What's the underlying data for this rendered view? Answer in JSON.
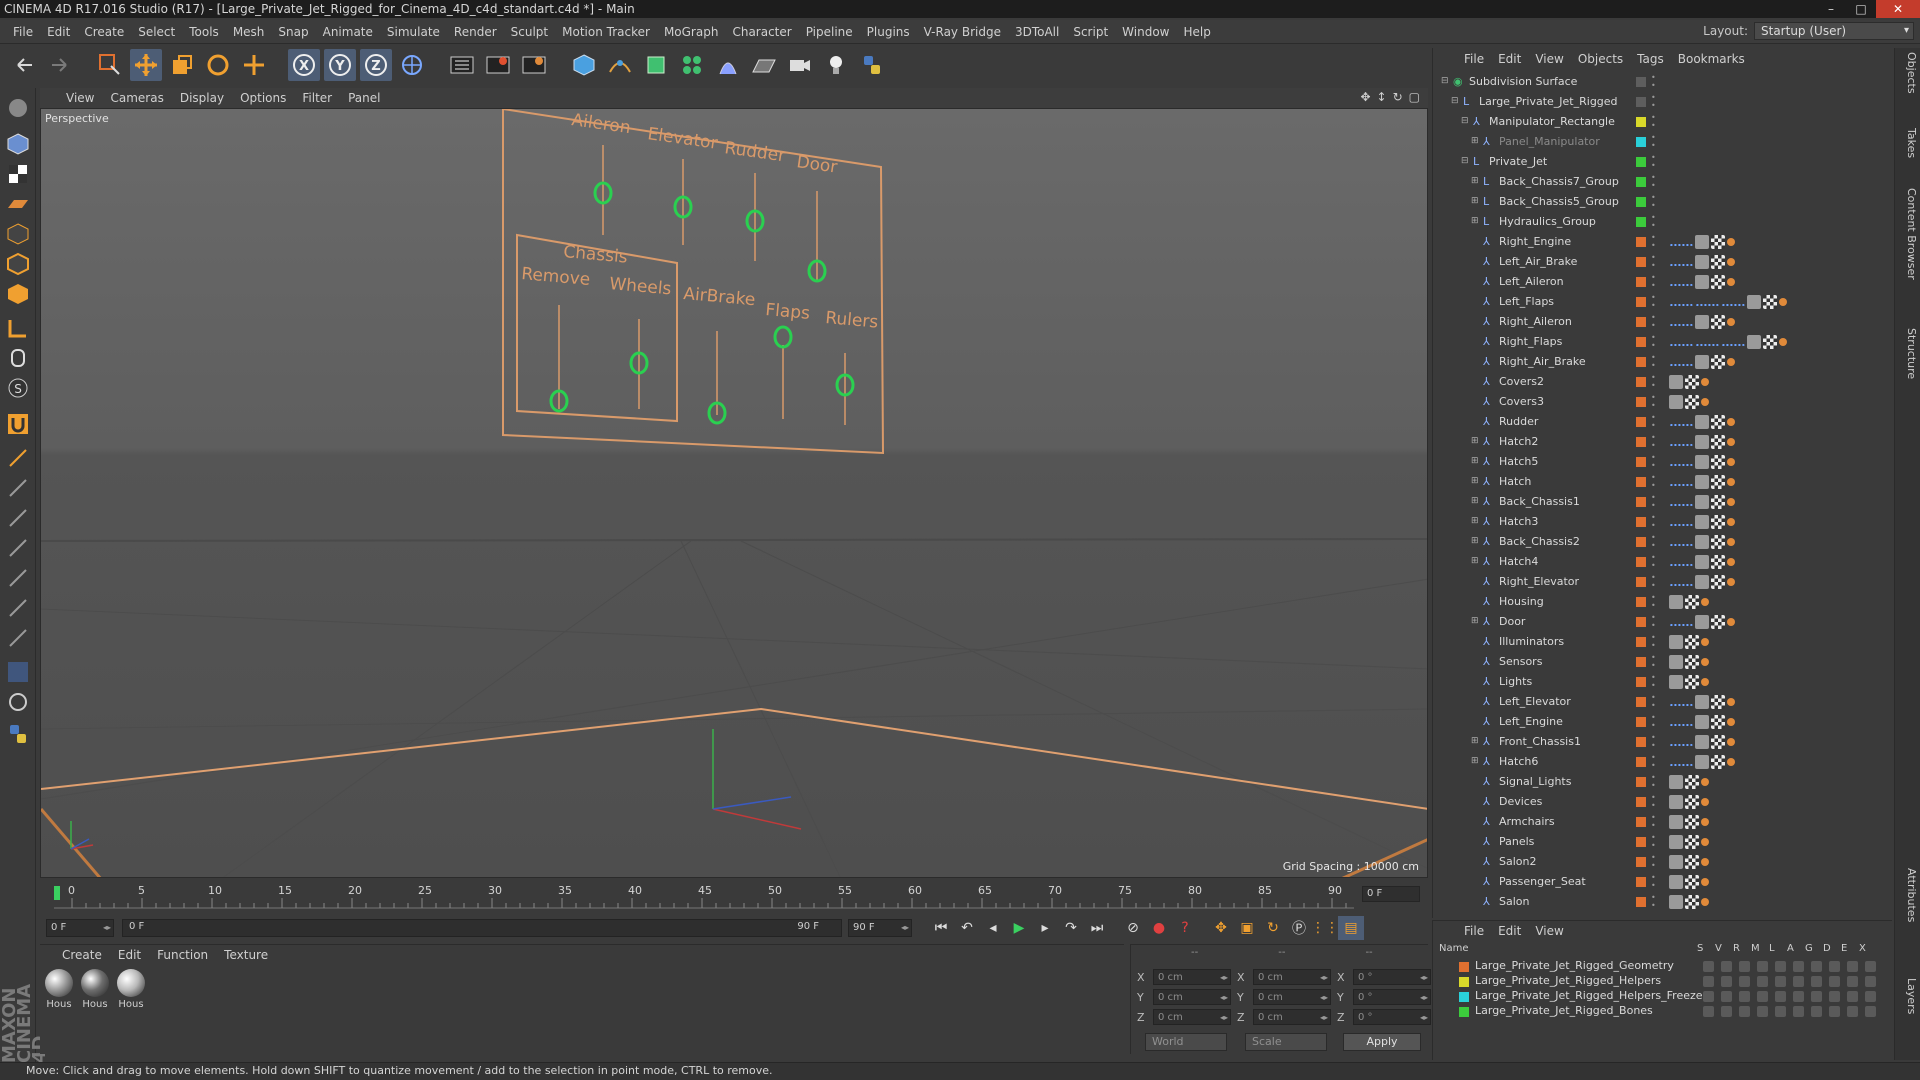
{
  "window": {
    "title": "CINEMA 4D R17.016 Studio (R17) - [Large_Private_Jet_Rigged_for_Cinema_4D_c4d_standart.c4d *] - Main"
  },
  "menubar": {
    "items": [
      "File",
      "Edit",
      "Create",
      "Select",
      "Tools",
      "Mesh",
      "Snap",
      "Animate",
      "Simulate",
      "Render",
      "Sculpt",
      "Motion Tracker",
      "MoGraph",
      "Character",
      "Pipeline",
      "Plugins",
      "V-Ray Bridge",
      "3DToAll",
      "Script",
      "Window",
      "Help"
    ],
    "layout_label": "Layout:",
    "layout_value": "Startup (User)"
  },
  "toolbar": {
    "icons": [
      "undo-icon",
      "redo-icon",
      "live-select-icon",
      "move-icon",
      "scale-icon",
      "rotate-icon",
      "move-active-icon",
      "x-axis-icon",
      "y-axis-icon",
      "z-axis-icon",
      "world-coords-icon",
      "render-view-icon",
      "render-picture-viewer-icon",
      "edit-render-settings-icon",
      "cube-icon",
      "pen-spline-icon",
      "subdivision-nurbs-icon",
      "cloner-icon",
      "deformer-icon",
      "floor-icon",
      "camera-icon",
      "light-icon",
      "python-icon"
    ],
    "axis_labels": {
      "x": "X",
      "y": "Y",
      "z": "Z"
    }
  },
  "viewport": {
    "menu": [
      "View",
      "Cameras",
      "Display",
      "Options",
      "Filter",
      "Panel"
    ],
    "camera_label": "Perspective",
    "grid_spacing": "Grid Spacing : 10000 cm",
    "panel_labels": {
      "aileron": "Aileron",
      "elevator": "Elevator",
      "rudder": "Rudder",
      "door": "Door",
      "chassis": "Chassis",
      "remove": "Remove",
      "wheels": "Wheels",
      "airbrake": "AirBrake",
      "flaps": "Flaps",
      "rulers": "Rulers"
    }
  },
  "timeline": {
    "ticks": [
      "0",
      "5",
      "10",
      "15",
      "20",
      "25",
      "30",
      "35",
      "40",
      "45",
      "50",
      "55",
      "60",
      "65",
      "70",
      "75",
      "80",
      "85",
      "90"
    ],
    "current_frame": "0 F"
  },
  "transport": {
    "start_frame": "0 F",
    "range_start": "0 F",
    "range_end": "90 F",
    "end_frame": "90 F"
  },
  "material_manager": {
    "menu": [
      "Create",
      "Edit",
      "Function",
      "Texture"
    ],
    "materials": [
      {
        "label": "Hous",
        "color": "#9a9a9a"
      },
      {
        "label": "Hous",
        "color": "#6e6e6e"
      },
      {
        "label": "Hous",
        "color": "#b8b8b8"
      }
    ]
  },
  "coordinates": {
    "headers": [
      "--",
      "--",
      "--"
    ],
    "rows": [
      {
        "axis": "X",
        "pos": "0 cm",
        "axis2": "X",
        "size": "0 cm",
        "axis3": "X",
        "rot": "0 °"
      },
      {
        "axis": "Y",
        "pos": "0 cm",
        "axis2": "Y",
        "size": "0 cm",
        "axis3": "Y",
        "rot": "0 °"
      },
      {
        "axis": "Z",
        "pos": "0 cm",
        "axis2": "Z",
        "size": "0 cm",
        "axis3": "Z",
        "rot": "0 °"
      }
    ],
    "mode_world": "World",
    "mode_scale": "Scale",
    "apply_label": "Apply"
  },
  "status": {
    "text": "Move: Click and drag to move elements. Hold down SHIFT to quantize movement / add to the selection in point mode, CTRL to remove."
  },
  "object_manager": {
    "menu": [
      "File",
      "Edit",
      "View",
      "Objects",
      "Tags",
      "Bookmarks"
    ],
    "objects": [
      {
        "name": "Subdivision Surface",
        "depth": 0,
        "exp": "−",
        "layer": "",
        "icon": "subdivision-icon"
      },
      {
        "name": "Large_Private_Jet_Rigged",
        "depth": 1,
        "exp": "−",
        "layer": "",
        "icon": "null-icon"
      },
      {
        "name": "Manipulator_Rectangle",
        "depth": 2,
        "exp": "−",
        "layer": "#d9d92a",
        "icon": "spline-icon"
      },
      {
        "name": "Panel_Manipulator",
        "depth": 3,
        "exp": "+",
        "layer": "#2ad0d9",
        "icon": "spline-icon",
        "dim": true
      },
      {
        "name": "Private_Jet",
        "depth": 2,
        "exp": "−",
        "layer": "#3ccb3c",
        "icon": "null-icon"
      },
      {
        "name": "Back_Chassis7_Group",
        "depth": 3,
        "exp": "+",
        "layer": "#3ccb3c",
        "icon": "null-icon"
      },
      {
        "name": "Back_Chassis5_Group",
        "depth": 3,
        "exp": "+",
        "layer": "#3ccb3c",
        "icon": "null-icon"
      },
      {
        "name": "Hydraulics_Group",
        "depth": 3,
        "exp": "+",
        "layer": "#3ccb3c",
        "icon": "null-icon"
      },
      {
        "name": "Right_Engine",
        "depth": 3,
        "exp": "",
        "layer": "#e07030",
        "icon": "polygon-icon",
        "tags": "full"
      },
      {
        "name": "Left_Air_Brake",
        "depth": 3,
        "exp": "",
        "layer": "#e07030",
        "icon": "polygon-icon",
        "tags": "full"
      },
      {
        "name": "Left_Aileron",
        "depth": 3,
        "exp": "",
        "layer": "#e07030",
        "icon": "polygon-icon",
        "tags": "full"
      },
      {
        "name": "Left_Flaps",
        "depth": 3,
        "exp": "",
        "layer": "#e07030",
        "icon": "polygon-icon",
        "tags": "long"
      },
      {
        "name": "Right_Aileron",
        "depth": 3,
        "exp": "",
        "layer": "#e07030",
        "icon": "polygon-icon",
        "tags": "full"
      },
      {
        "name": "Right_Flaps",
        "depth": 3,
        "exp": "",
        "layer": "#e07030",
        "icon": "polygon-icon",
        "tags": "long"
      },
      {
        "name": "Right_Air_Brake",
        "depth": 3,
        "exp": "",
        "layer": "#e07030",
        "icon": "polygon-icon",
        "tags": "full"
      },
      {
        "name": "Covers2",
        "depth": 3,
        "exp": "",
        "layer": "#e07030",
        "icon": "polygon-icon",
        "tags": "short"
      },
      {
        "name": "Covers3",
        "depth": 3,
        "exp": "",
        "layer": "#e07030",
        "icon": "polygon-icon",
        "tags": "short"
      },
      {
        "name": "Rudder",
        "depth": 3,
        "exp": "",
        "layer": "#e07030",
        "icon": "polygon-icon",
        "tags": "full"
      },
      {
        "name": "Hatch2",
        "depth": 3,
        "exp": "+",
        "layer": "#e07030",
        "icon": "polygon-icon",
        "tags": "full"
      },
      {
        "name": "Hatch5",
        "depth": 3,
        "exp": "+",
        "layer": "#e07030",
        "icon": "polygon-icon",
        "tags": "full"
      },
      {
        "name": "Hatch",
        "depth": 3,
        "exp": "+",
        "layer": "#e07030",
        "icon": "polygon-icon",
        "tags": "full"
      },
      {
        "name": "Back_Chassis1",
        "depth": 3,
        "exp": "+",
        "layer": "#e07030",
        "icon": "polygon-icon",
        "tags": "full"
      },
      {
        "name": "Hatch3",
        "depth": 3,
        "exp": "+",
        "layer": "#e07030",
        "icon": "polygon-icon",
        "tags": "full"
      },
      {
        "name": "Back_Chassis2",
        "depth": 3,
        "exp": "+",
        "layer": "#e07030",
        "icon": "polygon-icon",
        "tags": "full"
      },
      {
        "name": "Hatch4",
        "depth": 3,
        "exp": "+",
        "layer": "#e07030",
        "icon": "polygon-icon",
        "tags": "full"
      },
      {
        "name": "Right_Elevator",
        "depth": 3,
        "exp": "",
        "layer": "#e07030",
        "icon": "polygon-icon",
        "tags": "full"
      },
      {
        "name": "Housing",
        "depth": 3,
        "exp": "",
        "layer": "#e07030",
        "icon": "polygon-icon",
        "tags": "short"
      },
      {
        "name": "Door",
        "depth": 3,
        "exp": "+",
        "layer": "#e07030",
        "icon": "polygon-icon",
        "tags": "full"
      },
      {
        "name": "Illuminators",
        "depth": 3,
        "exp": "",
        "layer": "#e07030",
        "icon": "polygon-icon",
        "tags": "short"
      },
      {
        "name": "Sensors",
        "depth": 3,
        "exp": "",
        "layer": "#e07030",
        "icon": "polygon-icon",
        "tags": "short"
      },
      {
        "name": "Lights",
        "depth": 3,
        "exp": "",
        "layer": "#e07030",
        "icon": "polygon-icon",
        "tags": "short"
      },
      {
        "name": "Left_Elevator",
        "depth": 3,
        "exp": "",
        "layer": "#e07030",
        "icon": "polygon-icon",
        "tags": "full"
      },
      {
        "name": "Left_Engine",
        "depth": 3,
        "exp": "",
        "layer": "#e07030",
        "icon": "polygon-icon",
        "tags": "full"
      },
      {
        "name": "Front_Chassis1",
        "depth": 3,
        "exp": "+",
        "layer": "#e07030",
        "icon": "polygon-icon",
        "tags": "full"
      },
      {
        "name": "Hatch6",
        "depth": 3,
        "exp": "+",
        "layer": "#e07030",
        "icon": "polygon-icon",
        "tags": "full"
      },
      {
        "name": "Signal_Lights",
        "depth": 3,
        "exp": "",
        "layer": "#e07030",
        "icon": "polygon-icon",
        "tags": "short"
      },
      {
        "name": "Devices",
        "depth": 3,
        "exp": "",
        "layer": "#e07030",
        "icon": "polygon-icon",
        "tags": "short"
      },
      {
        "name": "Armchairs",
        "depth": 3,
        "exp": "",
        "layer": "#e07030",
        "icon": "polygon-icon",
        "tags": "short"
      },
      {
        "name": "Panels",
        "depth": 3,
        "exp": "",
        "layer": "#e07030",
        "icon": "polygon-icon",
        "tags": "short"
      },
      {
        "name": "Salon2",
        "depth": 3,
        "exp": "",
        "layer": "#e07030",
        "icon": "polygon-icon",
        "tags": "short"
      },
      {
        "name": "Passenger_Seat",
        "depth": 3,
        "exp": "",
        "layer": "#e07030",
        "icon": "polygon-icon",
        "tags": "short"
      },
      {
        "name": "Salon",
        "depth": 3,
        "exp": "",
        "layer": "#e07030",
        "icon": "polygon-icon",
        "tags": "short"
      }
    ]
  },
  "layer_manager": {
    "menu": [
      "File",
      "Edit",
      "View"
    ],
    "header_name": "Name",
    "header_cols": [
      "S",
      "V",
      "R",
      "M",
      "L",
      "A",
      "G",
      "D",
      "E",
      "X"
    ],
    "layers": [
      {
        "name": "Large_Private_Jet_Rigged_Geometry",
        "color": "#e07030"
      },
      {
        "name": "Large_Private_Jet_Rigged_Helpers",
        "color": "#d9d92a"
      },
      {
        "name": "Large_Private_Jet_Rigged_Helpers_Freeze",
        "color": "#2ad0d9"
      },
      {
        "name": "Large_Private_Jet_Rigged_Bones",
        "color": "#3ccb3c"
      }
    ]
  },
  "side_tabs": [
    "Objects",
    "Takes",
    "Content Browser",
    "Structure",
    "Attributes",
    "Layers"
  ],
  "brand": "MAXON CINEMA 4D"
}
